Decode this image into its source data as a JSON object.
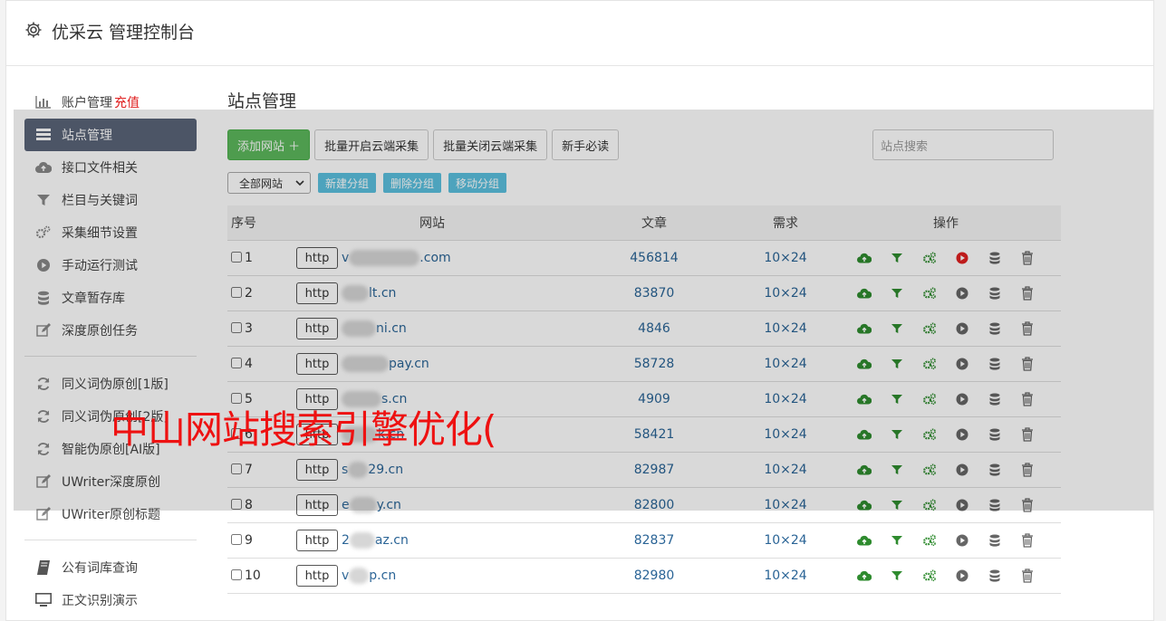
{
  "header": {
    "title": "优采云 管理控制台",
    "icon": "gear-icon"
  },
  "sidebar": {
    "groups": [
      [
        {
          "label": "账户管理",
          "badge": "充值",
          "icon": "bar-chart-icon"
        },
        {
          "label": "站点管理",
          "icon": "server-icon",
          "active": true
        },
        {
          "label": "接口文件相关",
          "icon": "cloud-upload-icon"
        },
        {
          "label": "栏目与关键词",
          "icon": "filter-icon"
        },
        {
          "label": "采集细节设置",
          "icon": "cogs-icon"
        },
        {
          "label": "手动运行测试",
          "icon": "play-circle-icon"
        },
        {
          "label": "文章暂存库",
          "icon": "database-icon"
        },
        {
          "label": "深度原创任务",
          "icon": "edit-icon"
        }
      ],
      [
        {
          "label": "同义词伪原创[1版]",
          "icon": "refresh-icon"
        },
        {
          "label": "同义词伪原创[2版]",
          "icon": "refresh-icon"
        },
        {
          "label": "智能伪原创[AI版]",
          "icon": "refresh-icon"
        },
        {
          "label": "UWriter深度原创",
          "icon": "edit-icon"
        },
        {
          "label": "UWriter原创标题",
          "icon": "edit-icon"
        }
      ],
      [
        {
          "label": "公有词库查询",
          "icon": "book-icon"
        },
        {
          "label": "正文识别演示",
          "icon": "monitor-icon"
        }
      ]
    ]
  },
  "main": {
    "title": "站点管理",
    "toolbar": {
      "add_site": "添加网站 ＋",
      "batch_on": "批量开启云端采集",
      "batch_off": "批量关闭云端采集",
      "guide": "新手必读",
      "search_placeholder": "站点搜索"
    },
    "group_select": "全部网站",
    "group_buttons": [
      "新建分组",
      "删除分组",
      "移动分组"
    ],
    "table": {
      "headers": [
        "序号",
        "网站",
        "文章",
        "需求",
        "操作"
      ],
      "rows": [
        {
          "no": "1",
          "prefix": "v",
          "suffix": ".com",
          "articles": "456814",
          "demand": "10×24",
          "run_red": true
        },
        {
          "no": "2",
          "prefix": "",
          "suffix": "lt.cn",
          "articles": "83870",
          "demand": "10×24"
        },
        {
          "no": "3",
          "prefix": "",
          "suffix": "ni.cn",
          "articles": "4846",
          "demand": "10×24"
        },
        {
          "no": "4",
          "prefix": "",
          "suffix": "pay.cn",
          "articles": "58728",
          "demand": "10×24"
        },
        {
          "no": "5",
          "prefix": "",
          "suffix": "s.cn",
          "articles": "4909",
          "demand": "10×24"
        },
        {
          "no": "6",
          "prefix": "",
          "suffix": "k.cn",
          "articles": "58421",
          "demand": "10×24"
        },
        {
          "no": "7",
          "prefix": "s",
          "suffix": "29.cn",
          "articles": "82987",
          "demand": "10×24"
        },
        {
          "no": "8",
          "prefix": "e",
          "suffix": "y.cn",
          "articles": "82800",
          "demand": "10×24"
        },
        {
          "no": "9",
          "prefix": "2",
          "suffix": "az.cn",
          "articles": "82837",
          "demand": "10×24"
        },
        {
          "no": "10",
          "prefix": "v",
          "suffix": "p.cn",
          "articles": "82980",
          "demand": "10×24"
        }
      ],
      "http_label": "http"
    }
  },
  "watermark": "中山网站搜索引擎优化(",
  "colors": {
    "active_bg": "#5a6478",
    "green": "#5cb85c",
    "blue": "#5bc0de",
    "link": "#2a6496",
    "icon_green": "#2e8b2e",
    "red": "#e02020"
  }
}
